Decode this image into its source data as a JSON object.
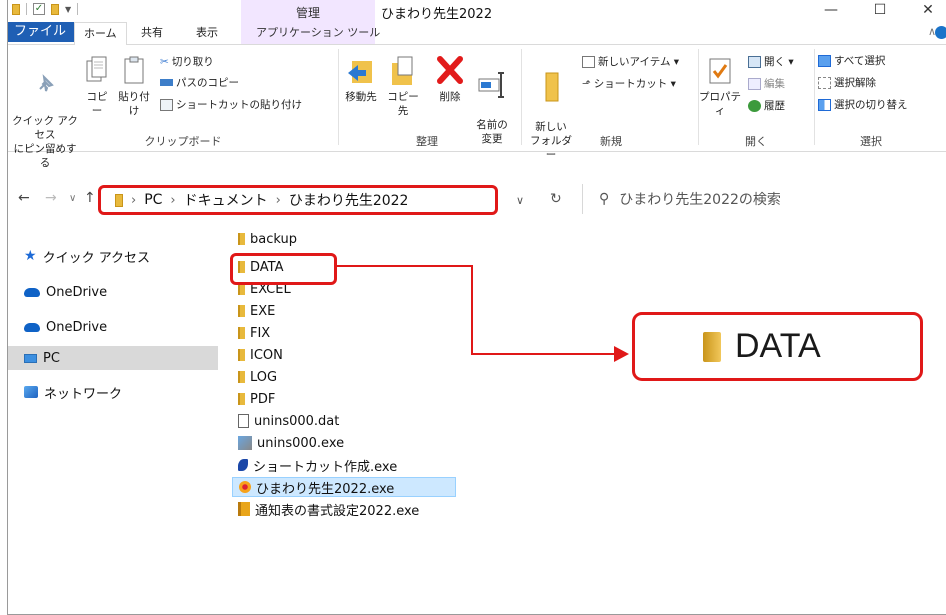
{
  "window": {
    "title": "ひまわり先生2022",
    "manage_tab": "管理",
    "min": "—",
    "max": "☐",
    "close": "✕"
  },
  "tabs": [
    "ファイル",
    "ホーム",
    "共有",
    "表示",
    "アプリケーション ツール"
  ],
  "ribbon": {
    "clipboard": {
      "label": "クリップボード",
      "pin": "クイック アクセス\nにピン留めする",
      "copy": "コピー",
      "paste": "貼り付け",
      "cut": "切り取り",
      "copy_path": "パスのコピー",
      "paste_shortcut": "ショートカットの貼り付け"
    },
    "organize": {
      "label": "整理",
      "move_to": "移動先",
      "copy_to": "コピー先",
      "delete": "削除",
      "rename": "名前の\n変更"
    },
    "new": {
      "label": "新規",
      "new_folder": "新しい\nフォルダー",
      "new_item": "新しいアイテム ▾",
      "shortcut": "ショートカット ▾"
    },
    "open": {
      "label": "開く",
      "properties": "プロパティ",
      "open": "開く ▾",
      "edit": "編集",
      "history": "履歴"
    },
    "select": {
      "label": "選択",
      "select_all": "すべて選択",
      "select_none": "選択解除",
      "invert": "選択の切り替え"
    }
  },
  "address": {
    "crumbs": [
      "PC",
      "ドキュメント",
      "ひまわり先生2022"
    ],
    "search_placeholder": "ひまわり先生2022の検索"
  },
  "nav": [
    {
      "label": "クイック アクセス",
      "icon": "star-icon"
    },
    {
      "label": "OneDrive",
      "icon": "cloud-icon"
    },
    {
      "label": "OneDrive",
      "icon": "cloud-icon"
    },
    {
      "label": "PC",
      "icon": "pc-icon"
    },
    {
      "label": "ネットワーク",
      "icon": "network-icon"
    }
  ],
  "files": [
    {
      "name": "backup",
      "icon": "folder-icon"
    },
    {
      "name": "DATA",
      "icon": "folder-icon"
    },
    {
      "name": "EXCEL",
      "icon": "folder-icon"
    },
    {
      "name": "EXE",
      "icon": "folder-icon"
    },
    {
      "name": "FIX",
      "icon": "folder-icon"
    },
    {
      "name": "ICON",
      "icon": "folder-icon"
    },
    {
      "name": "LOG",
      "icon": "folder-icon"
    },
    {
      "name": "PDF",
      "icon": "folder-icon"
    },
    {
      "name": "unins000.dat",
      "icon": "document-icon"
    },
    {
      "name": "unins000.exe",
      "icon": "installer-icon"
    },
    {
      "name": "ショートカット作成.exe",
      "icon": "pen-icon"
    },
    {
      "name": "ひまわり先生2022.exe",
      "icon": "sunflower-icon"
    },
    {
      "name": "通知表の書式設定2022.exe",
      "icon": "book-icon"
    }
  ],
  "callout": {
    "label": "DATA"
  }
}
